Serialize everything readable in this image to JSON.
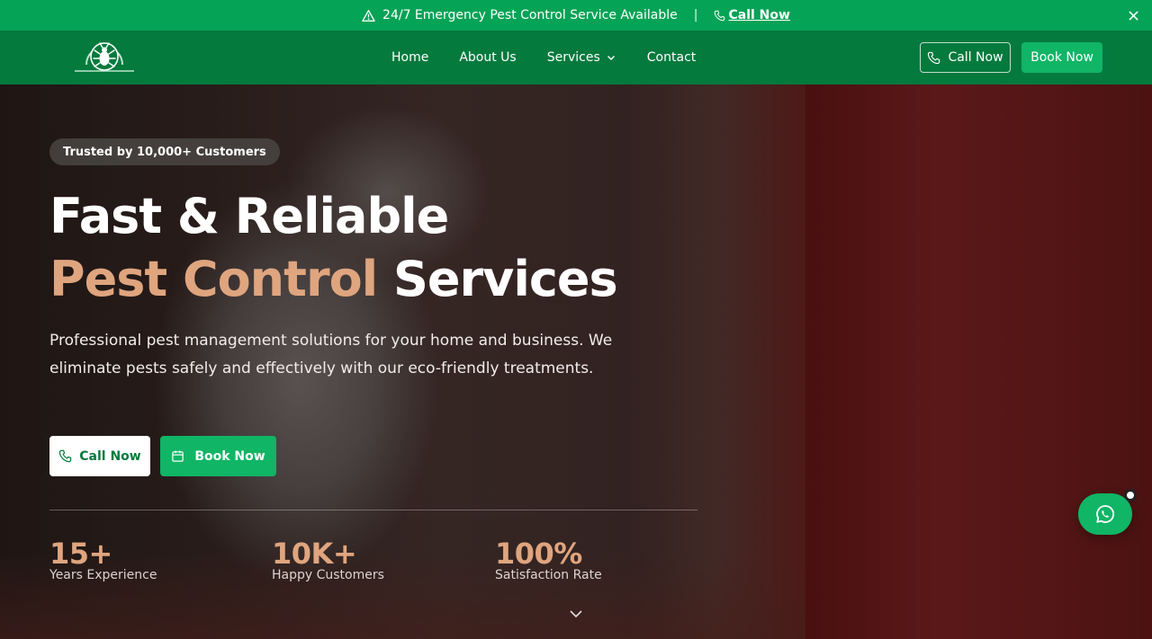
{
  "topbar": {
    "message": "24/7 Emergency Pest Control Service Available",
    "separator": "|",
    "call_link": "Call Now",
    "icons": {
      "warning": "warning-triangle-icon",
      "phone": "phone-icon",
      "close": "close-icon"
    }
  },
  "nav": {
    "links": [
      {
        "label": "Home"
      },
      {
        "label": "About Us"
      },
      {
        "label": "Services",
        "has_dropdown": true
      },
      {
        "label": "Contact"
      }
    ],
    "call_button": "Call Now",
    "book_button": "Book Now"
  },
  "hero": {
    "badge": "Trusted by 10,000+ Customers",
    "title_line1": "Fast & Reliable",
    "title_accent": "Pest Control",
    "title_rest": " Services",
    "lead": "Professional pest management solutions for your home and business. We eliminate pests safely and effectively with our eco-friendly treatments.",
    "cta_call": "Call Now",
    "cta_book": "Book Now",
    "stats": [
      {
        "value": "15+",
        "label": "Years Experience"
      },
      {
        "value": "10K+",
        "label": "Happy Customers"
      },
      {
        "value": "100%",
        "label": "Satisfaction Rate"
      }
    ]
  },
  "colors": {
    "brand_green": "#05a356",
    "nav_green": "#047a3d",
    "button_green": "#10b566",
    "accent_tan": "#dfa57f"
  }
}
